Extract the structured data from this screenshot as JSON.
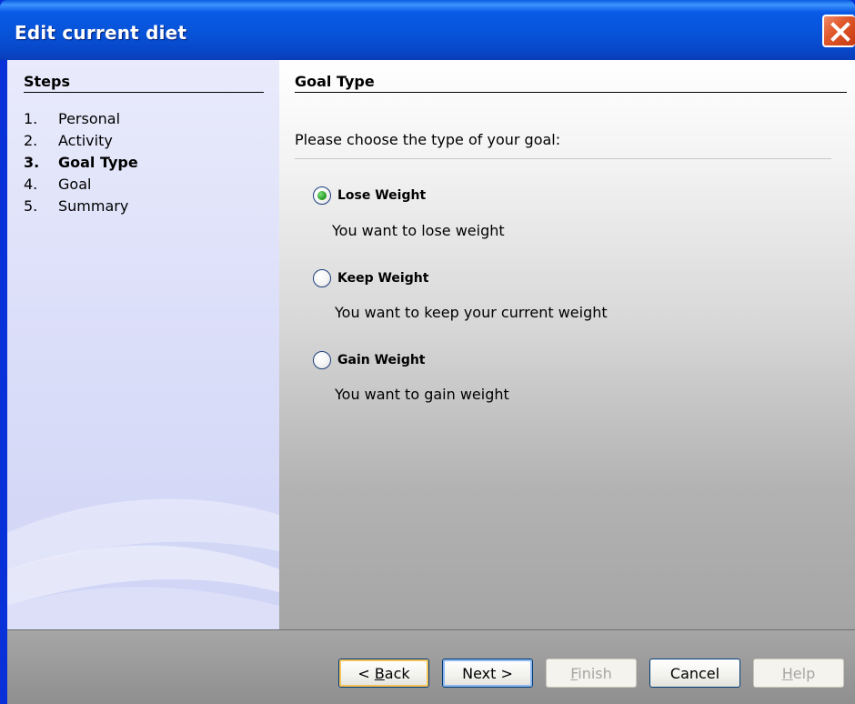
{
  "window": {
    "title": "Edit current diet"
  },
  "steps": {
    "title": "Steps",
    "items": [
      {
        "num": "1.",
        "label": "Personal"
      },
      {
        "num": "2.",
        "label": "Activity"
      },
      {
        "num": "3.",
        "label": "Goal Type",
        "active": true
      },
      {
        "num": "4.",
        "label": "Goal"
      },
      {
        "num": "5.",
        "label": "Summary"
      }
    ]
  },
  "panel": {
    "title": "Goal Type",
    "prompt": "Please choose the type of your goal:",
    "options": [
      {
        "label": "Lose Weight",
        "desc": "You want to lose weight",
        "selected": true
      },
      {
        "label": "Keep Weight",
        "desc": "You want to keep your current weight",
        "selected": false
      },
      {
        "label": "Gain Weight",
        "desc": "You want to gain weight",
        "selected": false
      }
    ]
  },
  "buttons": {
    "back": {
      "pre": "< ",
      "mnemonic": "B",
      "rest": "ack"
    },
    "next": "Next >",
    "finish": {
      "mnemonic": "F",
      "rest": "inish"
    },
    "cancel": "Cancel",
    "help": {
      "mnemonic": "H",
      "rest": "elp"
    }
  },
  "icons": {
    "close": "close-x-icon",
    "radio_selected": "radio-checked",
    "radio_unselected": "radio-unchecked"
  },
  "colors": {
    "title_bar": "#0754d9",
    "close_button": "#e05a2c",
    "radio_dot": "#2aa02a"
  }
}
